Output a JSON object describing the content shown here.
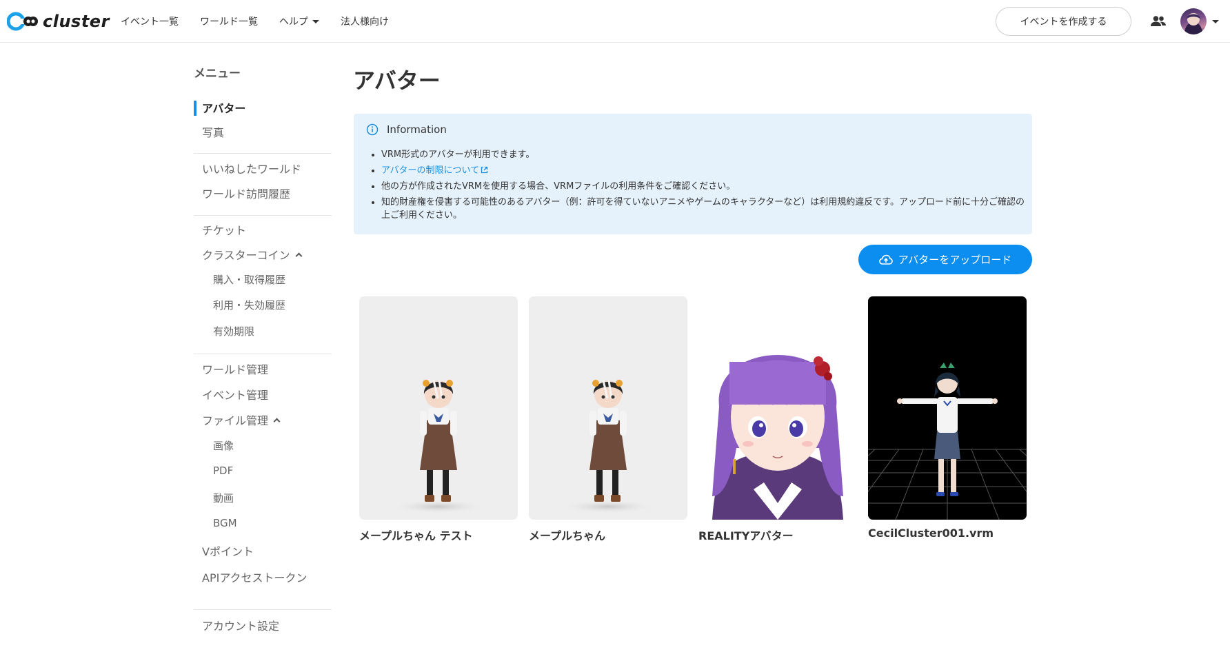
{
  "header": {
    "logo_text": "cluster",
    "nav": [
      {
        "label": "イベント一覧"
      },
      {
        "label": "ワールド一覧"
      },
      {
        "label": "ヘルプ",
        "has_dropdown": true
      },
      {
        "label": "法人様向け"
      }
    ],
    "create_event_label": "イベントを作成する"
  },
  "sidebar": {
    "heading": "メニュー",
    "items": [
      {
        "label": "アバター",
        "active": true
      },
      {
        "label": "写真"
      },
      {
        "label": "いいねしたワールド"
      },
      {
        "label": "ワールド訪問履歴"
      },
      {
        "label": "チケット"
      },
      {
        "label": "クラスターコイン",
        "expanded": true
      },
      {
        "label": "購入・取得履歴"
      },
      {
        "label": "利用・失効履歴"
      },
      {
        "label": "有効期限"
      },
      {
        "label": "ワールド管理"
      },
      {
        "label": "イベント管理"
      },
      {
        "label": "ファイル管理",
        "expanded": true
      },
      {
        "label": "画像"
      },
      {
        "label": "PDF"
      },
      {
        "label": "動画"
      },
      {
        "label": "BGM"
      },
      {
        "label": "Vポイント"
      },
      {
        "label": "APIアクセストークン"
      },
      {
        "label": "アカウント設定"
      }
    ]
  },
  "main": {
    "title": "アバター",
    "info": {
      "heading": "Information",
      "items": [
        "VRM形式のアバターが利用できます。",
        "アバターの制限について",
        "他の方が作成されたVRMを使用する場合、VRMファイルの利用条件をご確認ください。",
        "知的財産権を侵害する可能性のあるアバター（例：許可を得ていないアニメやゲームのキャラクターなど）は利用規約違反です。アップロード前に十分ご確認の上ご利用ください。"
      ]
    },
    "upload_label": "アバターをアップロード",
    "avatars": [
      {
        "name": "メープルちゃん テスト"
      },
      {
        "name": "メープルちゃん"
      },
      {
        "name": "REALITYアバター"
      },
      {
        "name": "CecilCluster001.vrm"
      }
    ]
  },
  "colors": {
    "accent": "#0b8ef0",
    "info_bg": "#e6f2fb",
    "active_bar": "#1a8fe3",
    "link": "#1a8fe3"
  }
}
